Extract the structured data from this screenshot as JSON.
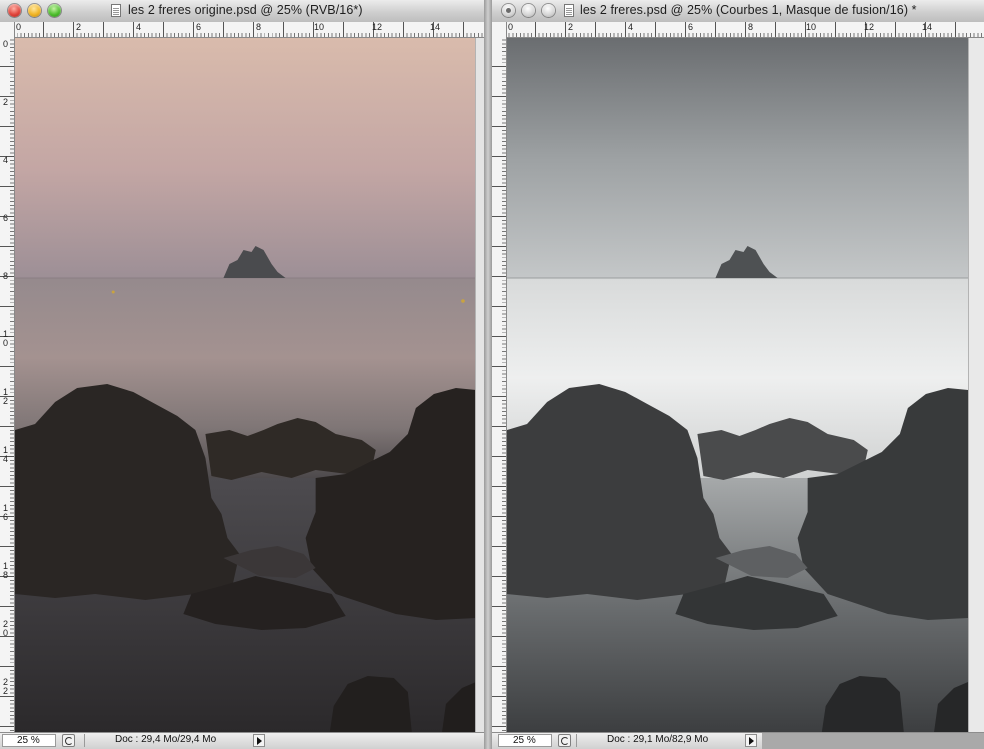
{
  "windows": {
    "left": {
      "title": "les 2 freres origine.psd @ 25% (RVB/16*)",
      "ruler_top": [
        "0",
        "2",
        "4",
        "6",
        "8",
        "10",
        "12",
        "14"
      ],
      "ruler_left": [
        "0",
        "2",
        "4",
        "6",
        "8",
        "10",
        "12",
        "14",
        "16",
        "18",
        "20",
        "22"
      ],
      "zoom": "25 %",
      "doc_info": "Doc : 29,4 Mo/29,4 Mo"
    },
    "right": {
      "title": "les 2 freres.psd @ 25% (Courbes 1, Masque de fusion/16) *",
      "ruler_top": [
        "0",
        "2",
        "4",
        "6",
        "8",
        "10",
        "12",
        "14"
      ],
      "zoom": "25 %",
      "doc_info": "Doc : 29,1 Mo/82,9 Mo"
    }
  },
  "colors": {
    "sky_top_warm": "#d7b8aa",
    "sky_mid_warm": "#b99e9e",
    "sea_warm": "#8f8384",
    "rock_dark": "#2a2522",
    "sky_top_gray": "#6f7274",
    "sky_mid_gray": "#b7babb",
    "sea_gray": "#e6e7e7",
    "rock_gray": "#3a3b3c"
  }
}
